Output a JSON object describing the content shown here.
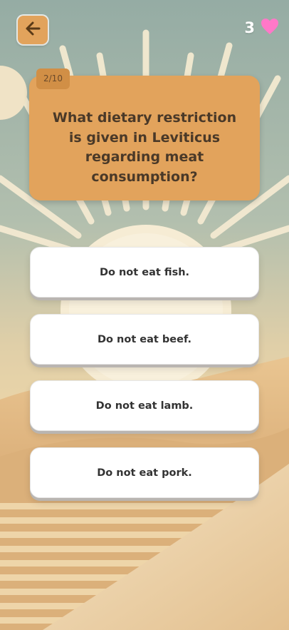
{
  "quiz": {
    "progress": "2/10",
    "lives": "3",
    "question": "What dietary restriction is given in Leviticus regarding meat consumption?"
  },
  "answers": [
    {
      "label": "Do not eat fish."
    },
    {
      "label": "Do not eat beef."
    },
    {
      "label": "Do not eat lamb."
    },
    {
      "label": "Do not eat pork."
    }
  ],
  "icons": {
    "back": "arrow-left-icon",
    "lives": "heart-icon"
  },
  "colors": {
    "accent": "#e2a35c",
    "heart": "#ff78c8",
    "sky": "#9fb5ac",
    "sand": "#e6c08a"
  }
}
